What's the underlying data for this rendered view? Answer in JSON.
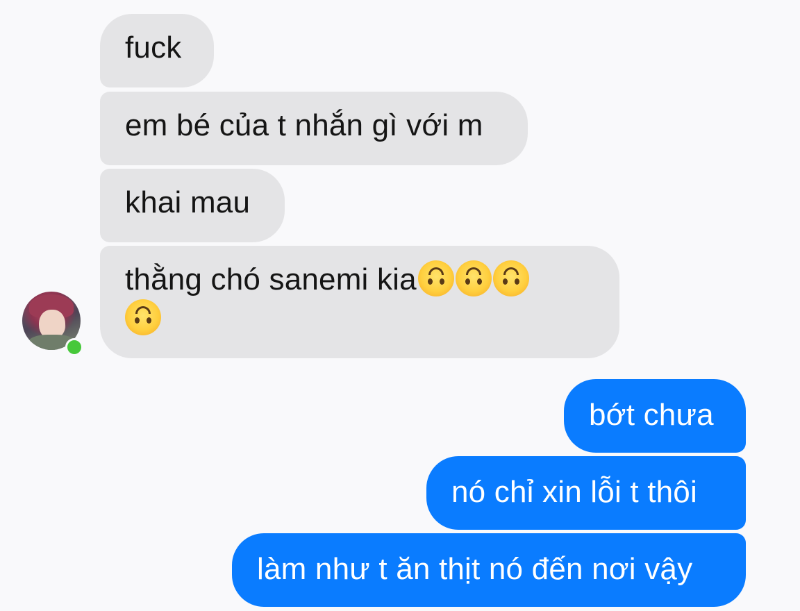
{
  "colors": {
    "background": "#f9f9fb",
    "incoming_bubble": "#e4e4e6",
    "outgoing_bubble": "#0a7cff",
    "online_status": "#47c83a"
  },
  "contact": {
    "avatar_icon": "contact-avatar",
    "online": true
  },
  "messages": [
    {
      "direction": "incoming",
      "text": "fuck"
    },
    {
      "direction": "incoming",
      "text": "em bé của t nhắn gì với m"
    },
    {
      "direction": "incoming",
      "text": "khai mau"
    },
    {
      "direction": "incoming",
      "text": "thằng chó sanemi kia",
      "emoji": "upside-down-face",
      "emoji_count": 4
    },
    {
      "direction": "outgoing",
      "text": "bớt chưa"
    },
    {
      "direction": "outgoing",
      "text": "nó chỉ xin lỗi t thôi"
    },
    {
      "direction": "outgoing",
      "text": "làm như t ăn thịt nó đến nơi vậy"
    }
  ]
}
